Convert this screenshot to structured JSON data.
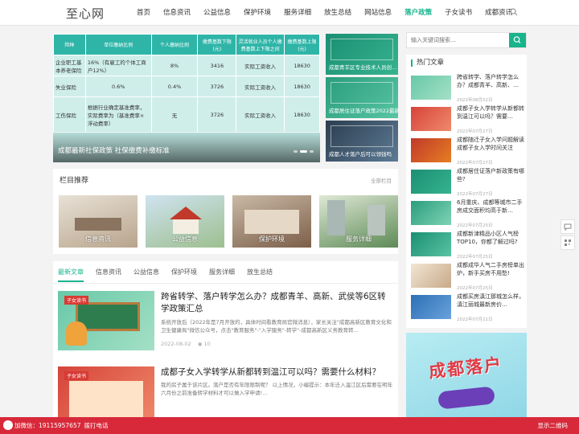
{
  "header": {
    "logo": "至心网",
    "nav": [
      "首页",
      "信息资讯",
      "公益信息",
      "保护环境",
      "服务详细",
      "放生总结",
      "网站信息",
      "落户政策",
      "子女读书",
      "成都资讯"
    ],
    "active_index": 7
  },
  "slider": {
    "caption": "成都最新社保政策 社保缴费补缴标准",
    "table": {
      "headers": [
        "险种",
        "单位缴纳比例",
        "个人缴纳比例",
        "缴费基数下限(元)",
        "灵活就业人员个人缴费基数上下限之间",
        "缴费基数上限(元)"
      ],
      "rows": [
        [
          "企业职工基本养老保险",
          "16%（有雇工的个体工商户12%）",
          "8%",
          "3416",
          "实际工资收入",
          "18630"
        ],
        [
          "失业保险",
          "0.6%",
          "0.4%",
          "3726",
          "实际工资收入",
          "18630"
        ],
        [
          "工伤保险",
          "根据行业确定基准费率，实际费率为（基准费率×浮动费率）",
          "无",
          "3726",
          "实际工资收入",
          "18630"
        ]
      ]
    },
    "thumbs": [
      "成都青羊区专业技术人员创…",
      "成都居住证落户政策2022最新",
      "成都人才落户后可以领钱吗"
    ]
  },
  "column_rec": {
    "title": "栏目推荐",
    "more": "全部栏目",
    "cards": [
      "信息资讯",
      "公益信息",
      "保护环境",
      "服务详细"
    ]
  },
  "articles": {
    "tabs": [
      "最新文章",
      "信息资讯",
      "公益信息",
      "保护环境",
      "服务详细",
      "放生总结"
    ],
    "items": [
      {
        "badge": "子女读书",
        "title": "跨省转学、落户转学怎么办？成都青羊、高新、武侯等6区转学政策汇总",
        "desc": "系统开放后（2022年是7月开放的，具体时间看教育局官微消息），家长关注\"成都高新区教育文化和卫生健康局\"微信公众号，点击\"教育服务\"-\"入学服务\"-转学\"-成都高新区义务教育转…",
        "date": "2022-08-02",
        "views": "10"
      },
      {
        "badge": "子女读书",
        "title": "成都子女入学转学从新都转到温江可以吗？需要什么材料？",
        "desc": "我的房子属于该片区。落户是否有年限限制呢？ 以上情况，小编提示：本年迁入温江区后需要在明年六月份之前准备转学材料才可以做入学申请!…",
        "date": "",
        "views": ""
      }
    ]
  },
  "sidebar": {
    "search_placeholder": "输入关键词搜索...",
    "hot_title": "热门文章",
    "hot": [
      {
        "title": "跨省转学、落户转学怎么办？成都青羊、高新、…",
        "date": "2022年08月02日"
      },
      {
        "title": "成都子女入学转学从新都转到温江可以吗？需要…",
        "date": "2022年07月27日"
      },
      {
        "title": "成都随迁子女入学问题解读 成都子女入学时间关注",
        "date": "2022年07月27日"
      },
      {
        "title": "成都居住证落户新政策有哪些?",
        "date": "2022年07月27日"
      },
      {
        "title": "6月重庆、成都等城市二手房成交面积均高于新…",
        "date": "2022年07月25日"
      },
      {
        "title": "成都新津精品小区人气榜TOP10，你都了解过吗?",
        "date": "2022年07月25日"
      },
      {
        "title": "成都成华人气二手房榜单出炉，新手买房不用愁!",
        "date": "2022年07月25日"
      },
      {
        "title": "成都买房滇江那城怎么样，滇江丽城最新房价…",
        "date": "2022年07月21日"
      }
    ],
    "ad_text": "成都落户"
  },
  "bottombar": {
    "wechat": "加微信：19115957657",
    "call": "拨打电话",
    "qrcode": "显示二维码"
  }
}
